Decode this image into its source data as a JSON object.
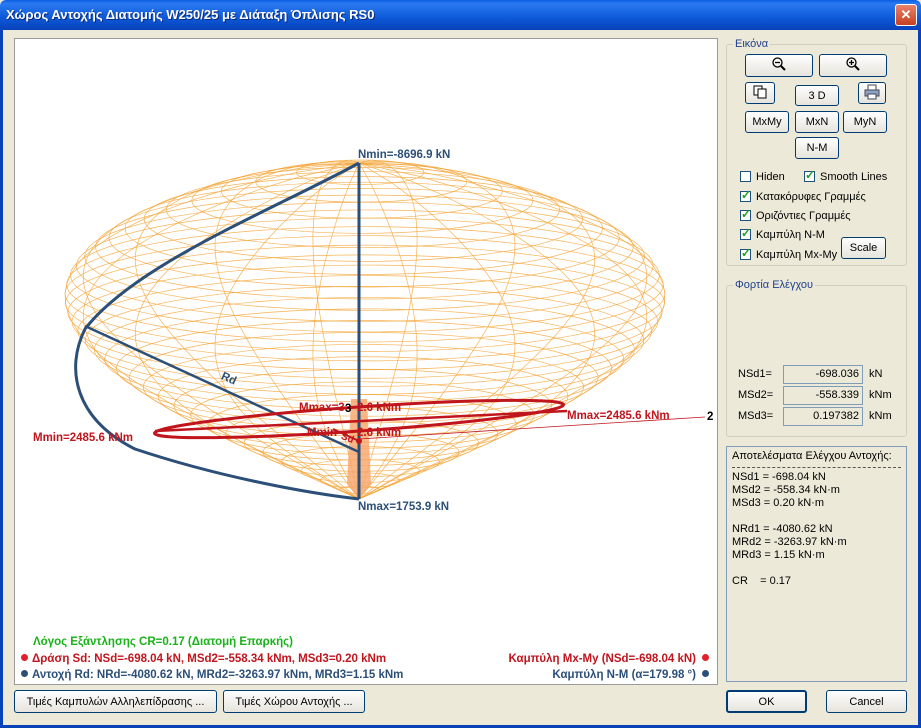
{
  "window": {
    "title": "Χώρος Αντοχής Διατομής W250/25 με Διάταξη Όπλισης RS0",
    "close_glyph": "✕"
  },
  "plot": {
    "labels": {
      "nmin": "Nmin=-8696.9 kN",
      "nmax": "Nmax=1753.9 kN",
      "mmax_right": "Mmax=2485.6 kNm",
      "mmin_left": "Mmin=2485.6 kNm",
      "mmax_center": "Mmax=3",
      "mmax_center_b": "2.6 kNm",
      "mmin_center": "Mmin",
      "mmin_center_b": "2.6 kNm",
      "axis_2": "2",
      "axis_3": "3",
      "rd": "Rd",
      "sd": "Sd"
    },
    "status": {
      "ratio": "Λόγος Εξάντλησης CR=0.17  (Διατομή Επαρκής)",
      "action": "Δράση  Sd: NSd=-698.04 kN,  MSd2=-558.34 kNm,  MSd3=0.20 kNm",
      "resistance": "Αντοχή Rd: NRd=-4080.62 kN,  MRd2=-3263.97 kNm,  MRd3=1.15 kNm",
      "curve_mxmy": "Καμπύλη Mx-My (NSd=-698.04 kN)",
      "curve_nm": "Καμπύλη N-M (α=179.98 °)"
    },
    "colors": {
      "blue": "#2c4f78",
      "red": "#c0151d",
      "orange": "#f4a63a",
      "green": "#19b219"
    }
  },
  "panel_image": {
    "title": "Εικόνα",
    "zoom_out_icon": "zoom-out-icon",
    "zoom_in_icon": "zoom-in-icon",
    "copy_icon": "copy-icon",
    "print_icon": "printer-icon",
    "btn_3d": "3 D",
    "btn_mxmy": "MxMy",
    "btn_mxn": "MxN",
    "btn_myn": "MyN",
    "btn_nm": "N-M",
    "chk_hiden": "Hiden",
    "chk_smooth": "Smooth Lines",
    "chk_vertical": "Κατακόρυφες Γραμμές",
    "chk_horizontal": "Οριζόντιες Γραμμές",
    "chk_nm": "Καμπύλη N-M",
    "chk_mxmy": "Καμπύλη Mx-My",
    "btn_scale": "Scale"
  },
  "panel_loads": {
    "title": "Φορτία Ελέγχου",
    "nsd1_label": "NSd1=",
    "nsd1_value": "-698.036",
    "nsd1_unit": "kN",
    "msd2_label": "MSd2=",
    "msd2_value": "-558.339",
    "msd2_unit": "kNm",
    "msd3_label": "MSd3=",
    "msd3_value": "0.197382",
    "msd3_unit": "kNm"
  },
  "results": {
    "title": "Αποτελέσματα Ελέγχου Αντοχής:",
    "nsd1": "NSd1 = -698.04 kN",
    "msd2": "MSd2 = -558.34 kN·m",
    "msd3": "MSd3 = 0.20 kN·m",
    "nrd1": "NRd1 = -4080.62 kN",
    "mrd2": "MRd2 = -3263.97 kN·m",
    "mrd3": "MRd3 = 1.15 kN·m",
    "cr": "CR    = 0.17"
  },
  "footer": {
    "btn_curves": "Τιμές Καμπυλών Αλληλεπίδρασης ...",
    "btn_space": "Τιμές Χώρου Αντοχής ...",
    "btn_ok": "OK",
    "btn_cancel": "Cancel"
  }
}
